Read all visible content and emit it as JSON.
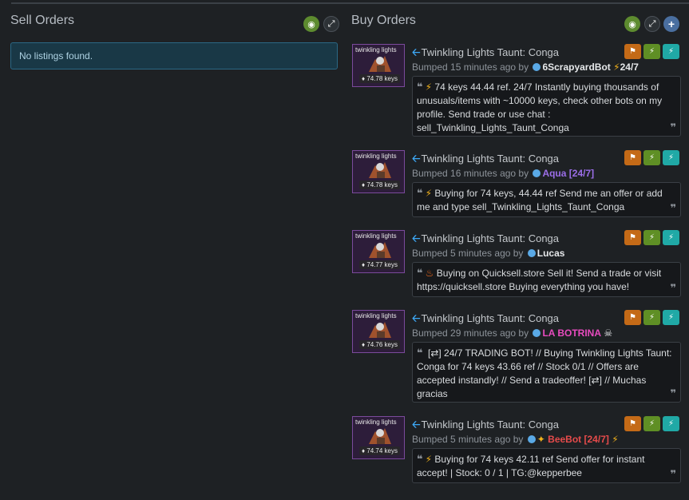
{
  "sell": {
    "title": "Sell Orders",
    "empty_text": "No listings found."
  },
  "buy": {
    "title": "Buy Orders"
  },
  "icons": {
    "eye": "eye-icon",
    "expand": "expand-icon",
    "plus": "plus-icon",
    "flag": "flag-icon",
    "bolt": "lightning-icon",
    "quote": "quote-icon"
  },
  "colors": {
    "background": "#1e2124",
    "purple_border": "#7b4a9c",
    "flag_btn": "#c46a17",
    "bolt_btn": "#5f8f25",
    "bolt2_btn": "#20a9a6"
  },
  "listings": [
    {
      "item_name": "Twinkling Lights Taunt: Conga",
      "thumb_name": "twinkling lights",
      "price": "74.78 keys",
      "bumped": "Bumped 15 minutes ago by",
      "user": "6ScrapyardBot",
      "user_suffix": "24/7",
      "message": "74 keys 44.44 ref. 24/7 Instantly buying thousands of unusuals/items with ~10000 keys, check other bots on my profile. Send trade or use chat : sell_Twinkling_Lights_Taunt_Conga"
    },
    {
      "item_name": "Twinkling Lights Taunt: Conga",
      "thumb_name": "twinkling lights",
      "price": "74.78 keys",
      "bumped": "Bumped 16 minutes ago by",
      "user": "Aqua [24/7]",
      "message": "Buying for 74 keys, 44.44 ref Send me an offer or add me and type sell_Twinkling_Lights_Taunt_Conga"
    },
    {
      "item_name": "Twinkling Lights Taunt: Conga",
      "thumb_name": "twinkling lights",
      "price": "74.77 keys",
      "bumped": "Bumped 5 minutes ago by",
      "user": "Lucas",
      "message": "Buying on Quicksell.store Sell it! Send a trade or visit https://quicksell.store Buying everything you have!"
    },
    {
      "item_name": "Twinkling Lights Taunt: Conga",
      "thumb_name": "twinkling lights",
      "price": "74.76 keys",
      "bumped": "Bumped 29 minutes ago by",
      "user": "LA BOTRINA",
      "message": "[⇄] 24/7 TRADING BOT! // Buying Twinkling Lights Taunt: Conga for 74 keys 43.66 ref // Stock 0/1 // Offers are accepted instandly! // Send a tradeoffer! [⇄] // Muchas gracias"
    },
    {
      "item_name": "Twinkling Lights Taunt: Conga",
      "thumb_name": "twinkling lights",
      "price": "74.74 keys",
      "bumped": "Bumped 5 minutes ago by",
      "user": "BeeBot [24/7]",
      "message": "Buying for 74 keys 42.11 ref Send offer for instant accept! | Stock: 0 / 1 | TG:@kepperbee"
    }
  ]
}
